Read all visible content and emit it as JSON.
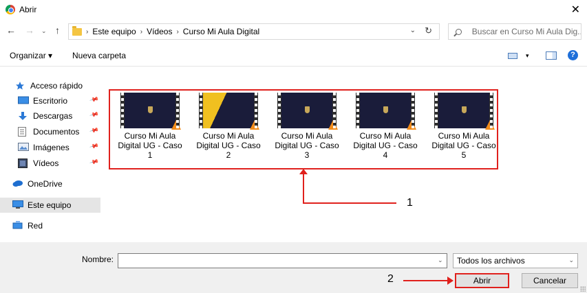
{
  "window": {
    "title": "Abrir",
    "close_glyph": "✕"
  },
  "nav": {
    "back_glyph": "←",
    "forward_glyph": "→",
    "recent_glyph": "⌄",
    "up_glyph": "↑",
    "breadcrumbs": [
      "Este equipo",
      "Vídeos",
      "Curso Mi Aula Digital"
    ],
    "separator": "›",
    "refresh_glyph": "↻",
    "search_placeholder": "Buscar en Curso Mi Aula Dig..."
  },
  "toolbar": {
    "organizar": "Organizar ▾",
    "nueva_carpeta": "Nueva carpeta",
    "view_dropdown": "▾",
    "help": "?"
  },
  "sidebar": {
    "items": [
      {
        "label": "Acceso rápido",
        "icon": "star-icon",
        "pinned": false
      },
      {
        "label": "Escritorio",
        "icon": "desktop-icon",
        "pinned": true
      },
      {
        "label": "Descargas",
        "icon": "download-icon",
        "pinned": true
      },
      {
        "label": "Documentos",
        "icon": "document-icon",
        "pinned": true
      },
      {
        "label": "Imágenes",
        "icon": "image-icon",
        "pinned": true
      },
      {
        "label": "Vídeos",
        "icon": "video-icon",
        "pinned": true
      },
      {
        "label": "OneDrive",
        "icon": "cloud-icon",
        "pinned": false
      },
      {
        "label": "Este equipo",
        "icon": "computer-icon",
        "pinned": false,
        "selected": true
      },
      {
        "label": "Red",
        "icon": "network-icon",
        "pinned": false
      }
    ],
    "pin_glyph": "📌"
  },
  "files": [
    {
      "line1": "Curso Mi Aula",
      "line2": "Digital UG - Caso",
      "line3": "1"
    },
    {
      "line1": "Curso Mi Aula",
      "line2": "Digital UG - Caso",
      "line3": "2"
    },
    {
      "line1": "Curso Mi Aula",
      "line2": "Digital UG - Caso",
      "line3": "3"
    },
    {
      "line1": "Curso Mi Aula",
      "line2": "Digital UG - Caso",
      "line3": "4"
    },
    {
      "line1": "Curso Mi Aula",
      "line2": "Digital UG - Caso",
      "line3": "5"
    }
  ],
  "annotations": {
    "callout_1": "1",
    "callout_2": "2",
    "color": "#e0201c"
  },
  "footer": {
    "nombre_label": "Nombre:",
    "nombre_value": "",
    "dropdown_glyph": "⌄",
    "filter_value": "Todos los archivos",
    "abrir": "Abrir",
    "cancelar": "Cancelar"
  },
  "colors": {
    "accent": "#1e6fd9",
    "selection": "#e5e5e5",
    "footer_bg": "#f0f0f0"
  }
}
